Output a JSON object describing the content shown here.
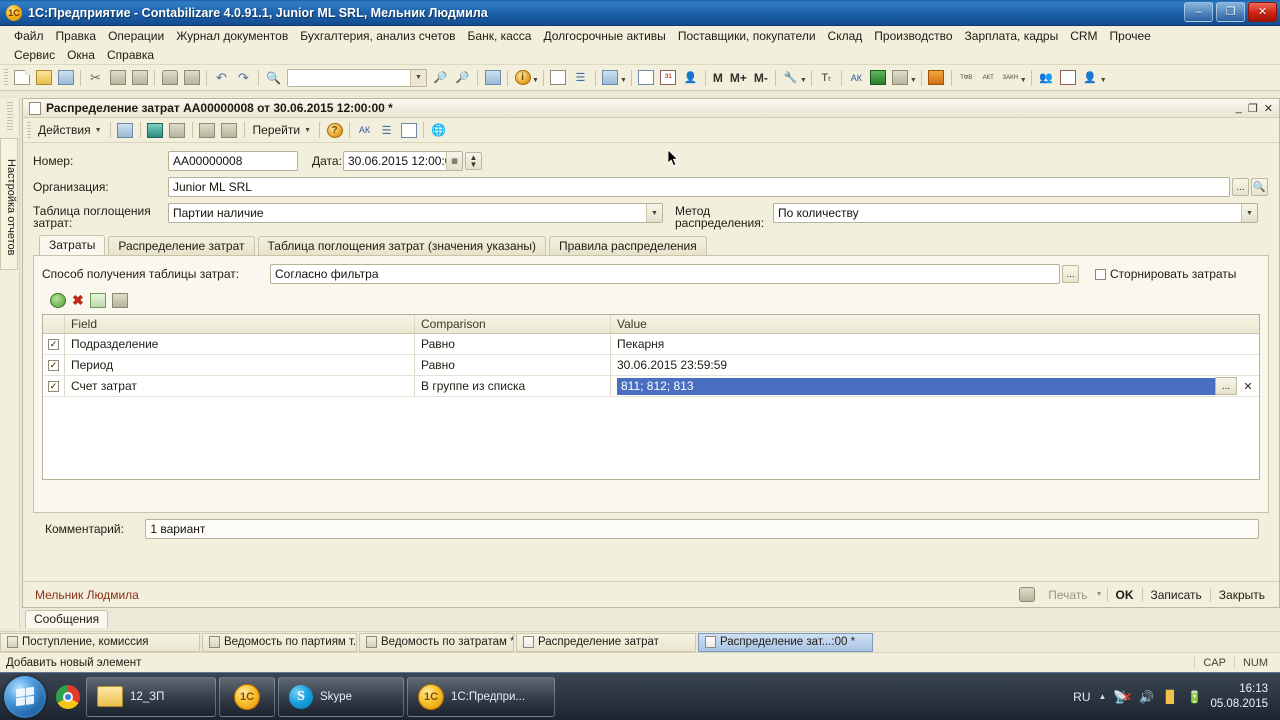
{
  "window": {
    "title": "1С:Предприятие - Contabilizare 4.0.91.1, Junior ML SRL, Мельник Людмила",
    "app_icon": "onec-icon",
    "minimize": "–",
    "maximize": "❐",
    "close": "✕"
  },
  "menubar": {
    "row1": [
      "Файл",
      "Правка",
      "Операции",
      "Журнал документов",
      "Бухгалтерия, анализ счетов",
      "Банк, касса",
      "Долгосрочные активы",
      "Поставщики, покупатели",
      "Склад",
      "Производство",
      "Зарплата, кадры",
      "CRM",
      "Прочее"
    ],
    "row2": [
      "Сервис",
      "Окна",
      "Справка"
    ]
  },
  "toolbar": {
    "search_value": "",
    "letters": [
      "M",
      "M+",
      "M-"
    ],
    "mini_labels": [
      "ТФВ",
      "АКТ",
      "ЗАКН"
    ]
  },
  "leftrail": {
    "vertical_tab": "Настройка отчетов"
  },
  "document": {
    "title": "Распределение затрат AA00000008 от 30.06.2015 12:00:00 *",
    "win_min": "_",
    "win_restore": "❐",
    "win_close": "✕",
    "actions_label": "Действия",
    "goto_label": "Перейти",
    "help_label": "?"
  },
  "form": {
    "number_label": "Номер:",
    "number_value": "AA00000008",
    "date_label": "Дата:",
    "date_value": "30.06.2015 12:00:00",
    "org_label": "Организация:",
    "org_value": "Junior ML SRL",
    "absorb_label_line1": "Таблица поглощения",
    "absorb_label_line2": "затрат:",
    "absorb_value": "Партии наличие",
    "method_label_line1": "Метод",
    "method_label_line2": "распределения:",
    "method_value": "По количеству",
    "comment_label": "Комментарий:",
    "comment_value": "1 вариант"
  },
  "tabs": [
    {
      "label": "Затраты",
      "active": true
    },
    {
      "label": "Распределение затрат",
      "active": false
    },
    {
      "label": "Таблица поглощения затрат (значения указаны)",
      "active": false
    },
    {
      "label": "Правила распределения",
      "active": false
    }
  ],
  "panel": {
    "source_label": "Способ получения таблицы затрат:",
    "source_value": "Согласно фильтра",
    "ellipsis_button": "...",
    "reverse_checkbox_label": "Сторнировать затраты",
    "reverse_checked": false,
    "grid_tools": [
      "add-row-icon",
      "delete-row-icon",
      "edit-row-icon",
      "copy-row-icon"
    ]
  },
  "grid": {
    "columns": [
      "Field",
      "Comparison",
      "Value"
    ],
    "rows": [
      {
        "checked": true,
        "field": "Подразделение",
        "comparison": "Равно",
        "value": "Пекарня",
        "selected": false
      },
      {
        "checked": true,
        "field": "Период",
        "comparison": "Равно",
        "value": "30.06.2015 23:59:59",
        "selected": false
      },
      {
        "checked": true,
        "field": "Счет затрат",
        "comparison": "В группе из списка",
        "value": "811; 812; 813",
        "selected": true
      }
    ],
    "selected_row_ellipsis": "...",
    "selected_row_clear": "✕"
  },
  "footer": {
    "user": "Мельник Людмила",
    "print_label": "Печать",
    "ok_label": "OK",
    "save_label": "Записать",
    "close_label": "Закрыть"
  },
  "messages_tab": {
    "label": "Сообщения"
  },
  "mdi_taskbar": [
    {
      "label": "Поступление, комиссия",
      "active": false,
      "icon": "mts-doc-icon"
    },
    {
      "label": "Ведомость по партиям т...",
      "active": false,
      "icon": "report-icon"
    },
    {
      "label": "Ведомость по затратам *",
      "active": false,
      "icon": "report-icon"
    },
    {
      "label": "Распределение затрат",
      "active": false,
      "icon": "doc-icon"
    },
    {
      "label": "Распределение зат...:00 *",
      "active": true,
      "icon": "doc-icon"
    }
  ],
  "statusbar": {
    "message": "Добавить новый элемент",
    "cap": "CAP",
    "num": "NUM"
  },
  "taskbar": {
    "start": "start-orb",
    "quick_launch": [
      "chrome-icon"
    ],
    "buttons": [
      {
        "label": "12_ЗП",
        "icon": "folder-icon"
      },
      {
        "label": "",
        "icon": "onec-icon"
      },
      {
        "label": "Skype",
        "icon": "skype-icon"
      },
      {
        "label": "1С:Предпри...",
        "icon": "onec-icon"
      }
    ],
    "tray": {
      "language": "RU",
      "show_hidden": "▲",
      "icons": [
        "network-error-icon",
        "volume-icon",
        "signal-icon",
        "battery-icon"
      ],
      "time": "16:13",
      "date": "05.08.2015"
    }
  }
}
